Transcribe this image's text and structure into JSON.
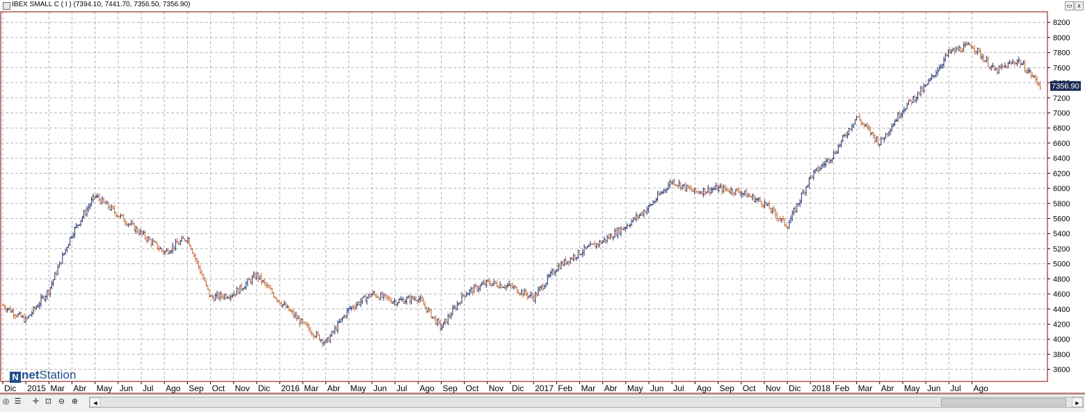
{
  "window": {
    "title": "IBEX SMALL C ( I ) (7394.10, 7441.70, 7356.50, 7356.90)",
    "minimize_glyph": "▭",
    "close_glyph": "x"
  },
  "logo": {
    "letter": "N",
    "text_bold": "net",
    "text": "Station"
  },
  "last_price_label": "7356.90",
  "toolbar": {
    "icons": [
      "globe-icon",
      "grid-icon",
      "crosshair-icon",
      "zoom-fit-icon",
      "zoom-out-icon",
      "zoom-in-icon"
    ],
    "scroll_left_glyph": "◄",
    "scroll_right_glyph": "►"
  },
  "colors": {
    "frame": "#8b0000",
    "grid": "#b4b4b4",
    "bar_up": "#1a2a6c",
    "bar_down": "#c0622d",
    "price_label_bg": "#1b2a55"
  },
  "chart_data": {
    "type": "ohlc",
    "title": "IBEX SMALL C ( I )",
    "last": {
      "open": 7394.1,
      "high": 7441.7,
      "low": 7356.5,
      "close": 7356.9
    },
    "y_ticks": [
      3600,
      3800,
      4000,
      4200,
      4400,
      4600,
      4800,
      5000,
      5200,
      5400,
      5600,
      5800,
      6000,
      6200,
      6400,
      6600,
      6800,
      7000,
      7200,
      7400,
      7600,
      7800,
      8000,
      8200
    ],
    "ylim": [
      3440,
      8340
    ],
    "x_labels": [
      "Dic",
      "2015",
      "Mar",
      "Abr",
      "May",
      "Jun",
      "Jul",
      "Ago",
      "Sep",
      "Oct",
      "Nov",
      "Dic",
      "2016",
      "Mar",
      "Abr",
      "May",
      "Jun",
      "Jul",
      "Ago",
      "Sep",
      "Oct",
      "Nov",
      "Dic",
      "2017",
      "Feb",
      "Mar",
      "Abr",
      "May",
      "Jun",
      "Jul",
      "Ago",
      "Sep",
      "Oct",
      "Nov",
      "Dic",
      "2018",
      "Feb",
      "Mar",
      "Abr",
      "May",
      "Jun",
      "Jul",
      "Ago"
    ],
    "grid": true,
    "price_path": [
      [
        "2014-12",
        4450
      ],
      [
        "2015-01",
        4250
      ],
      [
        "2015-02",
        4650
      ],
      [
        "2015-03",
        5400
      ],
      [
        "2015-04",
        5900
      ],
      [
        "2015-05",
        5650
      ],
      [
        "2015-06",
        5400
      ],
      [
        "2015-07",
        5150
      ],
      [
        "2015-08",
        5350
      ],
      [
        "2015-09",
        4550
      ],
      [
        "2015-10",
        4600
      ],
      [
        "2015-11",
        4850
      ],
      [
        "2015-12",
        4500
      ],
      [
        "2016-01",
        4200
      ],
      [
        "2016-02",
        3950
      ],
      [
        "2016-03",
        4400
      ],
      [
        "2016-04",
        4600
      ],
      [
        "2016-05",
        4500
      ],
      [
        "2016-06",
        4550
      ],
      [
        "2016-07",
        4150
      ],
      [
        "2016-08",
        4600
      ],
      [
        "2016-09",
        4750
      ],
      [
        "2016-10",
        4700
      ],
      [
        "2016-11",
        4550
      ],
      [
        "2016-12",
        4950
      ],
      [
        "2017-01",
        5150
      ],
      [
        "2017-02",
        5300
      ],
      [
        "2017-03",
        5500
      ],
      [
        "2017-04",
        5750
      ],
      [
        "2017-05",
        6100
      ],
      [
        "2017-06",
        5950
      ],
      [
        "2017-07",
        6000
      ],
      [
        "2017-08",
        5950
      ],
      [
        "2017-09",
        5800
      ],
      [
        "2017-10",
        5500
      ],
      [
        "2017-11",
        6150
      ],
      [
        "2017-12",
        6450
      ],
      [
        "2018-01",
        6950
      ],
      [
        "2018-02",
        6600
      ],
      [
        "2018-03",
        7050
      ],
      [
        "2018-04",
        7350
      ],
      [
        "2018-05",
        7800
      ],
      [
        "2018-06",
        7900
      ],
      [
        "2018-07",
        7550
      ],
      [
        "2018-08",
        7700
      ],
      [
        "2018-09",
        7357
      ]
    ]
  }
}
